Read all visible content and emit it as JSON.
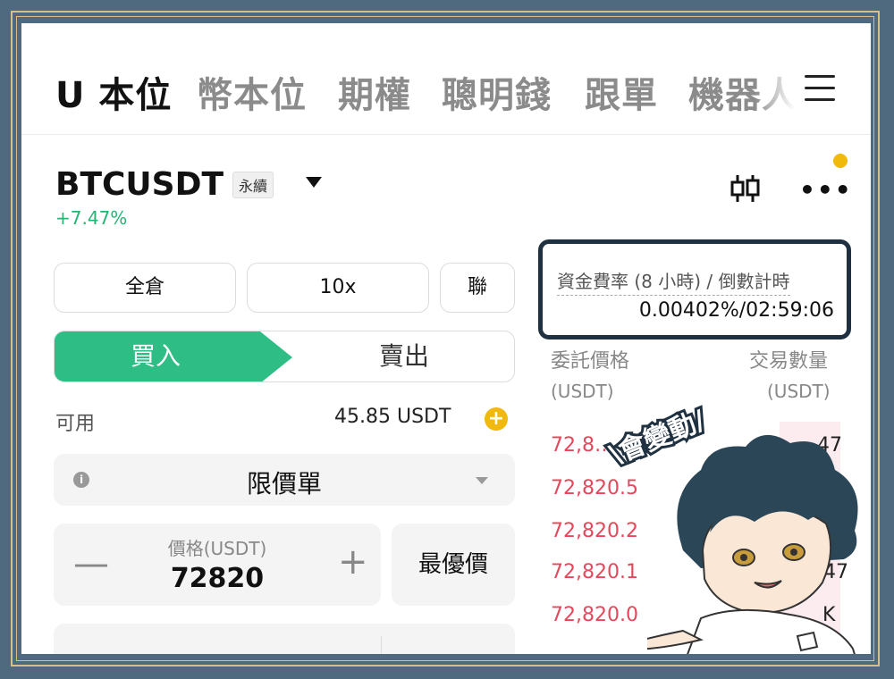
{
  "top_tabs": [
    "U 本位",
    "幣本位",
    "期權",
    "聰明錢",
    "跟單",
    "機器人"
  ],
  "pair": {
    "symbol": "BTCUSDT",
    "type": "永續",
    "change": "+7.47%"
  },
  "margin": {
    "mode": "全倉",
    "leverage": "10x",
    "asset_mode": "聯"
  },
  "side": {
    "buy": "買入",
    "sell": "賣出"
  },
  "available": {
    "label": "可用",
    "value": "45.85 USDT"
  },
  "order_type": "限價單",
  "price": {
    "label": "價格(USDT)",
    "value": "72820",
    "minus": "—",
    "plus": "+"
  },
  "best_price_button": "最優價",
  "funding": {
    "label": "資金費率 (8 小時) / 倒數計時",
    "value": "0.00402%/02:59:06"
  },
  "orderbook": {
    "price_header": "委託價格",
    "qty_header": "交易數量",
    "price_unit": "(USDT)",
    "qty_unit": "(USDT)",
    "rows": [
      {
        "price": "72,8…",
        "qty": "47"
      },
      {
        "price": "72,820.5",
        "qty": ""
      },
      {
        "price": "72,820.2",
        "qty": ""
      },
      {
        "price": "72,820.1",
        "qty": ".47"
      },
      {
        "price": "72,820.0",
        "qty": "K"
      }
    ]
  },
  "callout_text": "\\會變動/",
  "colors": {
    "buy": "#2ebd85",
    "sell": "#e6475a",
    "accent": "#f0b90b",
    "frame": "#4f6a7e",
    "frame_border": "#d8bf86"
  }
}
